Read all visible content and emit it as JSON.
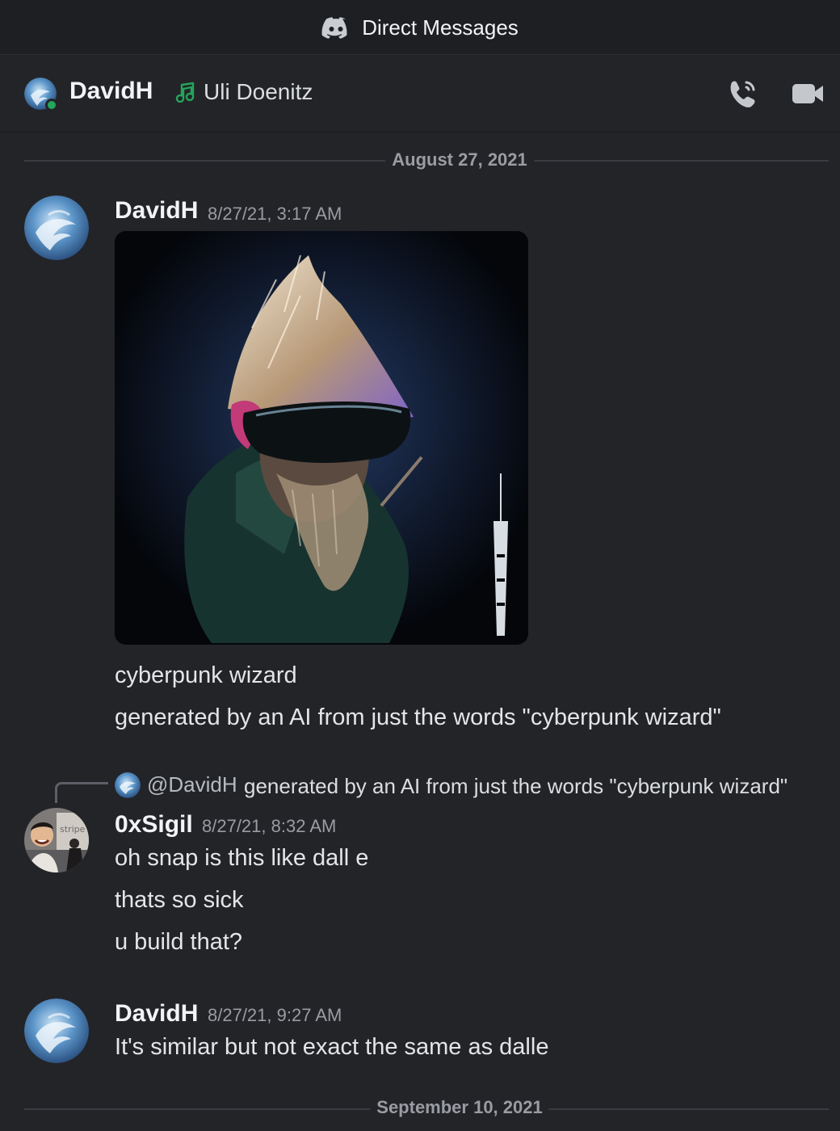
{
  "topbar": {
    "title": "Direct Messages",
    "icon": "discord-logo-icon"
  },
  "header": {
    "name": "DavidH",
    "activity": "Uli Doenitz",
    "activity_icon": "music-note-icon",
    "status_color": "#23a55a"
  },
  "dividers": {
    "first": "August 27, 2021",
    "second": "September 10, 2021"
  },
  "messages": [
    {
      "author": "DavidH",
      "timestamp": "8/27/21, 3:17 AM",
      "lines": [
        "cyberpunk wizard",
        "generated by an AI from just the words \"cyberpunk wizard\""
      ]
    },
    {
      "reply": {
        "mention": "@DavidH",
        "text": "generated by an AI from just the words \"cyberpunk wizard\""
      },
      "author": "0xSigil",
      "timestamp": "8/27/21, 8:32 AM",
      "lines": [
        "oh snap is this like dall e",
        "thats so sick",
        "u build that?"
      ],
      "avatar_text": "stripe"
    },
    {
      "author": "DavidH",
      "timestamp": "8/27/21, 9:27 AM",
      "lines": [
        "It's similar but not exact the same as dalle"
      ]
    }
  ],
  "colors": {
    "background": "#232428",
    "topbar": "#1e1f22",
    "online": "#23a55a"
  }
}
